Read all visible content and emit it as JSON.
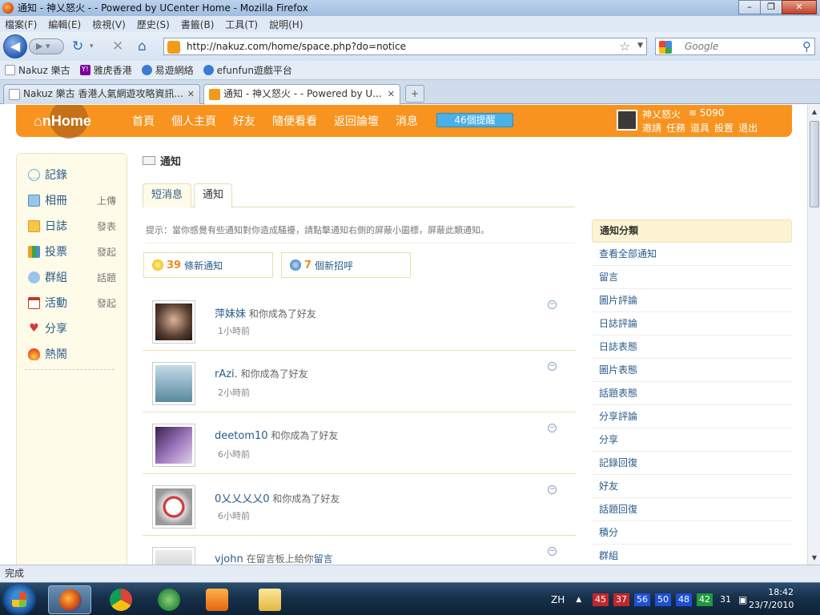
{
  "window": {
    "title": "通知 - 神乂怒火 - - Powered by UCenter Home - Mozilla Firefox",
    "buttons": [
      "–",
      "❐",
      "✕"
    ]
  },
  "menu": [
    "檔案(F)",
    "編輯(E)",
    "檢視(V)",
    "歷史(S)",
    "書籤(B)",
    "工具(T)",
    "說明(H)"
  ],
  "nav": {
    "url": "http://nakuz.com/home/space.php?do=notice",
    "search_placeholder": "Google"
  },
  "bookmarks": [
    {
      "label": "Nakuz 樂古",
      "color": "#ffffff"
    },
    {
      "label": "雅虎香港",
      "color": "#7b0099"
    },
    {
      "label": "易遊網絡",
      "color": "#3a7bd5"
    },
    {
      "label": "efunfun遊戲平台",
      "color": "#3a7bd5"
    }
  ],
  "tabs": [
    {
      "label": "Nakuz 樂古 香港人氣網遊攻略資訊...",
      "close": "✕"
    },
    {
      "label": "通知 - 神乂怒火 - - Powered by U...",
      "close": "✕"
    }
  ],
  "site": {
    "logo": "nHome",
    "nav_links": [
      "首頁",
      "個人主頁",
      "好友",
      "隨便看看",
      "返回論壇",
      "消息"
    ],
    "alert": "46個提醒",
    "username": "神乂怒火",
    "credit": "5090",
    "user_links": [
      "邀請",
      "任務",
      "道具",
      "設置",
      "退出"
    ]
  },
  "left_menu": [
    {
      "label": "記錄",
      "sub": "",
      "icon": "chat-bubble-icon",
      "color": "#6ab0e0"
    },
    {
      "label": "相冊",
      "sub": "上傳",
      "icon": "photo-icon",
      "color": "#4a8ec8"
    },
    {
      "label": "日誌",
      "sub": "發表",
      "icon": "journal-icon",
      "color": "#f2a62a"
    },
    {
      "label": "投票",
      "sub": "發起",
      "icon": "bar-chart-icon",
      "color": "#3fa34d"
    },
    {
      "label": "群組",
      "sub": "話題",
      "icon": "group-icon",
      "color": "#4a8ec8"
    },
    {
      "label": "活動",
      "sub": "發起",
      "icon": "calendar-icon",
      "color": "#c0392b"
    },
    {
      "label": "分享",
      "sub": "",
      "icon": "heart-share-icon",
      "color": "#d23b3b"
    },
    {
      "label": "熱鬧",
      "sub": "",
      "icon": "fire-icon",
      "color": "#e8521f"
    }
  ],
  "main": {
    "title": "通知",
    "subtabs": [
      "短消息",
      "通知"
    ],
    "hint": "提示：當你感覺有些通知對你造成騷擾，請點擊通知右側的屏蔽小圖標，屏蔽此類通知。",
    "summary": [
      {
        "count": "39",
        "label": "條新通知",
        "icon": "bulb-icon"
      },
      {
        "count": "7",
        "label": "個新招呼",
        "icon": "greeting-icon"
      }
    ],
    "notices": [
      {
        "who": "萍妹妹",
        "action": "和你成為了好友",
        "link": "",
        "time": "1小時前",
        "avatar": "#6f5c4c",
        "hide": "−"
      },
      {
        "who": "rAzi.",
        "action": "和你成為了好友",
        "link": "",
        "time": "2小時前",
        "avatar": "#4b6a7a",
        "hide": "−"
      },
      {
        "who": "deetom10",
        "action": "和你成為了好友",
        "link": "",
        "time": "6小時前",
        "avatar": "#6a4a8c",
        "hide": "−"
      },
      {
        "who": "0乂乂乂乂0",
        "action": "和你成為了好友",
        "link": "",
        "time": "6小時前",
        "avatar": "#c8c8c8",
        "hide": "−"
      },
      {
        "who": "vjohn",
        "action": "在留言板上給你",
        "link": "留言",
        "time": "",
        "avatar": "#d8d8d8",
        "hide": "−"
      }
    ]
  },
  "right_panel": {
    "title": "通知分類",
    "items": [
      "查看全部通知",
      "留言",
      "圖片評論",
      "日誌評論",
      "日誌表態",
      "圖片表態",
      "話題表態",
      "分享評論",
      "分享",
      "記錄回復",
      "好友",
      "話題回復",
      "積分",
      "群組"
    ]
  },
  "status": "完成",
  "taskbar": {
    "lang": "ZH",
    "counters": [
      {
        "value": "45",
        "color": "#c0282d"
      },
      {
        "value": "37",
        "color": "#c0282d"
      },
      {
        "value": "56",
        "color": "#1f4fd6"
      },
      {
        "value": "50",
        "color": "#1f4fd6"
      },
      {
        "value": "48",
        "color": "#1f4fd6"
      },
      {
        "value": "42",
        "color": "#1e9a3c"
      },
      {
        "value": "31",
        "color": "transparent"
      }
    ],
    "time": "18:42",
    "date": "23/7/2010"
  },
  "colors": {
    "site_orange": "#f7931e",
    "link_blue": "#2a5b8a",
    "count_orange": "#f28c1e"
  }
}
